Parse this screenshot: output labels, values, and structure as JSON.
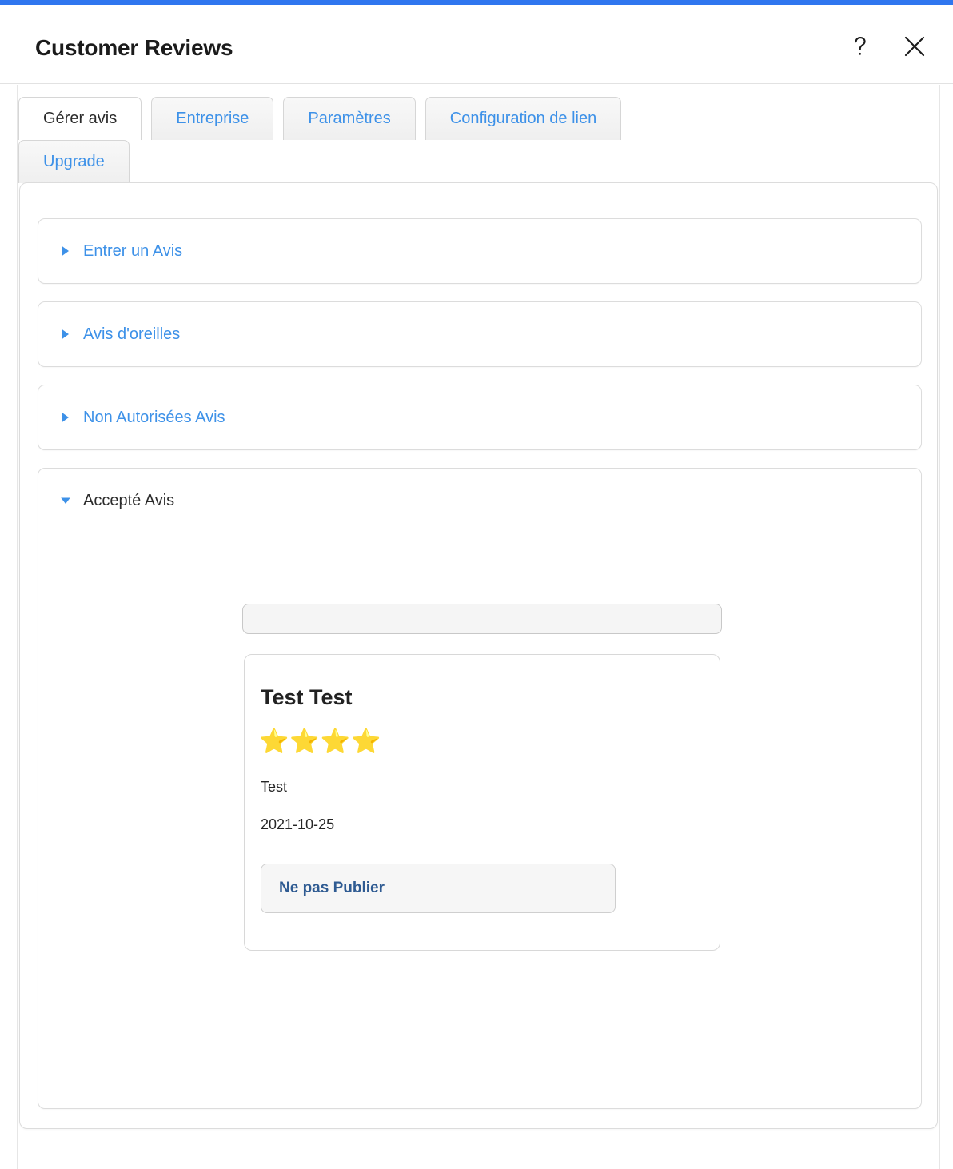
{
  "theme": {
    "accent_bar_color": "#2f76ef",
    "link_color": "#3d91e8",
    "button_text_color": "#2f5b92",
    "heading_color": "#1b1b1b"
  },
  "header": {
    "title": "Customer Reviews",
    "help_icon": "question-mark-icon",
    "close_icon": "close-icon"
  },
  "tabs": [
    {
      "label": "Gérer avis",
      "active": true
    },
    {
      "label": "Entreprise",
      "active": false
    },
    {
      "label": "Paramètres",
      "active": false
    },
    {
      "label": "Configuration de lien",
      "active": false
    },
    {
      "label": "Upgrade",
      "active": false
    }
  ],
  "accordion": [
    {
      "label": "Entrer un Avis",
      "expanded": false,
      "caret": "caret-right-icon"
    },
    {
      "label": "Avis d'oreilles",
      "expanded": false,
      "caret": "caret-right-icon"
    },
    {
      "label": "Non Autorisées Avis",
      "expanded": false,
      "caret": "caret-right-icon"
    },
    {
      "label": "Accepté Avis",
      "expanded": true,
      "caret": "caret-down-icon"
    }
  ],
  "accepted_reviews_panel": {
    "filter_input": {
      "value": "",
      "placeholder": ""
    },
    "review": {
      "name": "Test Test",
      "rating": 4,
      "max_rating": 5,
      "filled_star_glyph": "⭐",
      "empty_star_glyph": "⭐",
      "text": "Test",
      "date": "2021-10-25",
      "action_button_label": "Ne pas Publier"
    }
  }
}
